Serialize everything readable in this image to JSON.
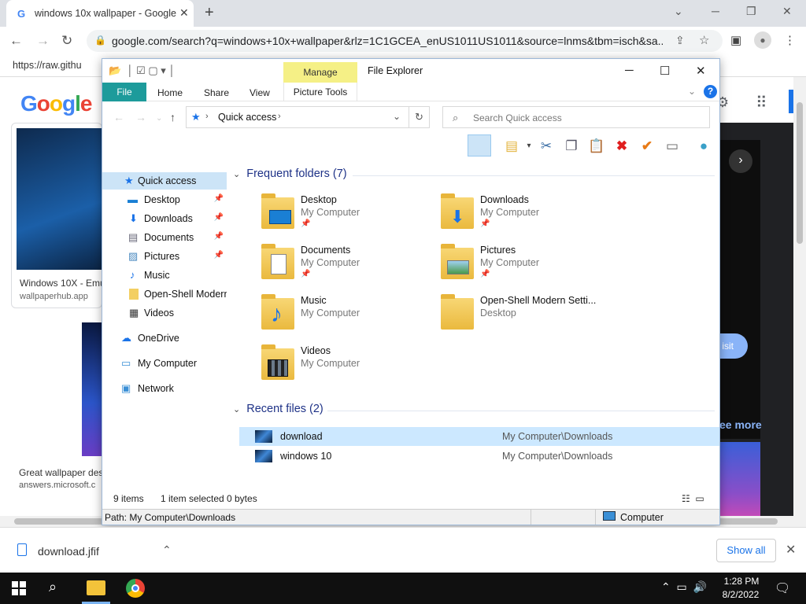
{
  "browser": {
    "tab_title": "windows 10x wallpaper - Google",
    "tab_favicon": "G",
    "new_tab": "+",
    "url": "google.com/search?q=windows+10x+wallpaper&rlz=1C1GCEA_enUS1011US1011&source=lnms&tbm=isch&sa...",
    "bookmark": "https://raw.githu"
  },
  "google": {
    "logo": [
      "G",
      "o",
      "o",
      "g",
      "l",
      "e"
    ],
    "card1_caption": "Windows 10X - Emu",
    "card1_source": "wallpaperhub.app",
    "card2_caption": "Great wallpaper des",
    "card2_source": "answers.microsoft.c",
    "visit_label": "isit",
    "see_more": "ee more"
  },
  "explorer": {
    "title": "File Explorer",
    "manage_tab": "Manage",
    "ribbon_tabs": {
      "file": "File",
      "home": "Home",
      "share": "Share",
      "view": "View",
      "picture_tools": "Picture Tools"
    },
    "address": "Quick access",
    "search_placeholder": "Search Quick access",
    "nav": {
      "quick_access": "Quick access",
      "desktop": "Desktop",
      "downloads": "Downloads",
      "documents": "Documents",
      "pictures": "Pictures",
      "music": "Music",
      "openshell": "Open-Shell Modern",
      "videos": "Videos",
      "onedrive": "OneDrive",
      "my_computer": "My Computer",
      "network": "Network"
    },
    "frequent_header": "Frequent folders (7)",
    "folders": [
      {
        "name": "Desktop",
        "location": "My Computer"
      },
      {
        "name": "Downloads",
        "location": "My Computer"
      },
      {
        "name": "Documents",
        "location": "My Computer"
      },
      {
        "name": "Pictures",
        "location": "My Computer"
      },
      {
        "name": "Music",
        "location": "My Computer"
      },
      {
        "name": "Open-Shell Modern Setti...",
        "location": "Desktop"
      },
      {
        "name": "Videos",
        "location": "My Computer"
      }
    ],
    "recent_header": "Recent files (2)",
    "recent": [
      {
        "name": "download",
        "path": "My Computer\\Downloads"
      },
      {
        "name": "windows 10",
        "path": "My Computer\\Downloads"
      }
    ],
    "status": {
      "items": "9 items",
      "selected": "1 item selected",
      "size": "0 bytes"
    },
    "path": "Path: My Computer\\Downloads",
    "location": "Computer"
  },
  "downloads_bar": {
    "file": "download.jfif",
    "show_all": "Show all"
  },
  "taskbar": {
    "time": "1:28 PM",
    "date": "8/2/2022"
  }
}
